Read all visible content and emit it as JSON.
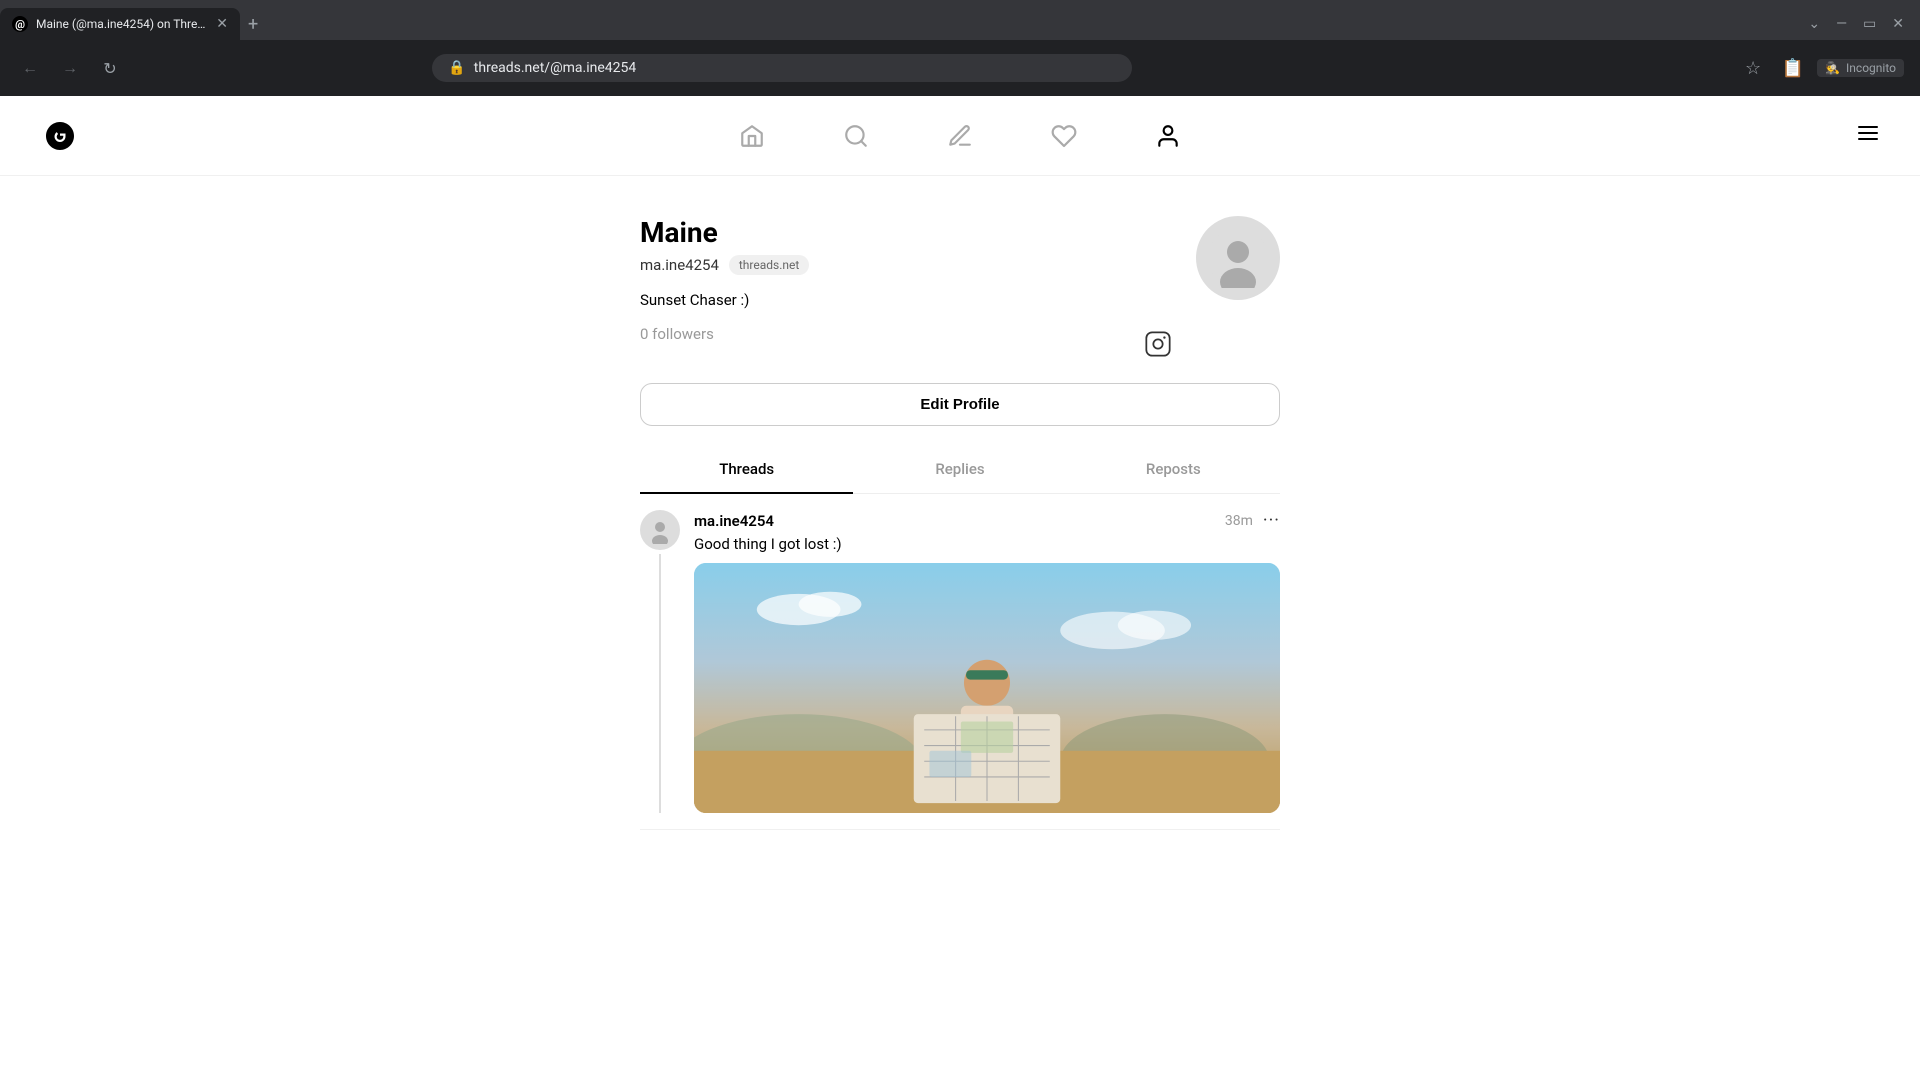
{
  "browser": {
    "tab_title": "Maine (@ma.ine4254) on Threa...",
    "tab_favicon": "T",
    "url": "threads.net/@ma.ine4254",
    "incognito_label": "Incognito"
  },
  "header": {
    "logo_alt": "Threads",
    "nav": {
      "home_icon": "⌂",
      "search_icon": "⌕",
      "compose_icon": "✎",
      "activity_icon": "♡",
      "profile_icon": "👤"
    },
    "menu_icon": "≡"
  },
  "profile": {
    "name": "Maine",
    "handle": "ma.ine4254",
    "badge": "threads.net",
    "bio": "Sunset Chaser :)",
    "followers": "0 followers",
    "edit_button": "Edit Profile",
    "instagram_icon": "instagram"
  },
  "tabs": {
    "threads": "Threads",
    "replies": "Replies",
    "reposts": "Reposts",
    "active": "threads"
  },
  "post": {
    "username": "ma.ine4254",
    "time": "38m",
    "more_icon": "•••",
    "text": "Good thing I got lost :)"
  },
  "colors": {
    "active_tab_border": "#000000",
    "border": "#e0e0e0",
    "text_muted": "#999999"
  }
}
